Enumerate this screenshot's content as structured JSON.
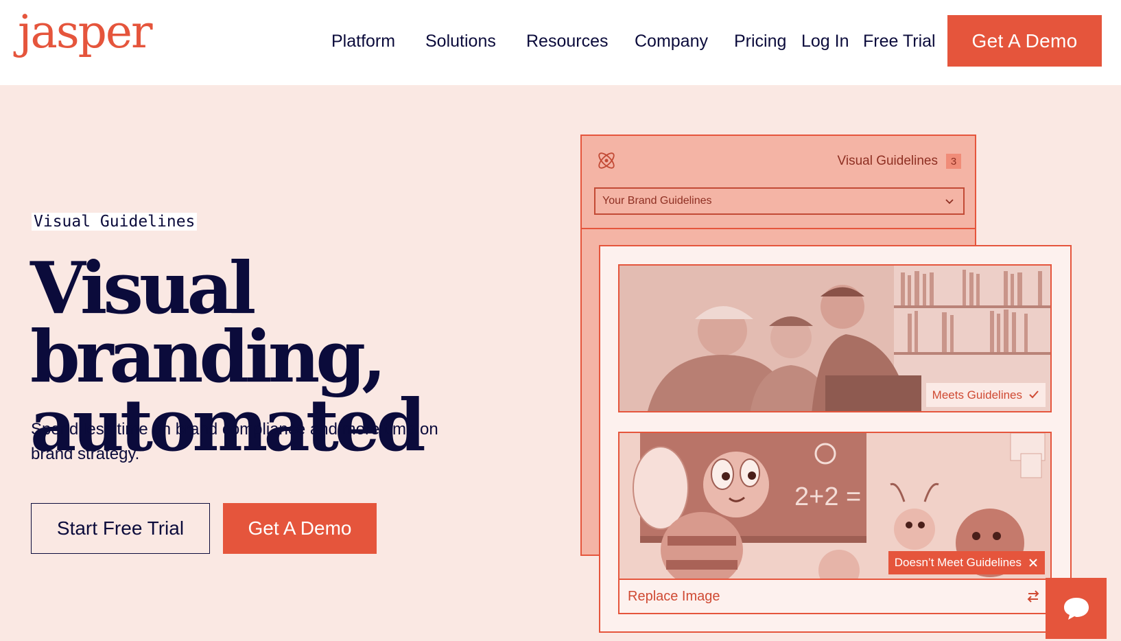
{
  "brand": {
    "logo_text": "jasper",
    "accent_color": "#e5553c",
    "navy": "#0b0b3b"
  },
  "nav": {
    "items": [
      "Platform",
      "Solutions",
      "Resources",
      "Company",
      "Pricing",
      "Log In",
      "Free Trial"
    ],
    "demo_label": "Get A Demo"
  },
  "hero": {
    "eyebrow": "Visual Guidelines",
    "headline_line1": "Visual branding,",
    "headline_line2": "automated",
    "subtext": "Spend less time on brand compliance and more time on brand strategy.",
    "trial_label": "Start Free Trial",
    "demo_label": "Get A Demo"
  },
  "app_mock": {
    "panel_title": "Visual Guidelines",
    "panel_count": "3",
    "select_value": "Your Brand Guidelines",
    "image1_status": "Meets Guidelines",
    "image1_status_icon": "check-icon",
    "image2_chalkboard_text": "2+2 =",
    "image2_status": "Doesn’t Meet Guidelines",
    "image2_status_icon": "close-icon",
    "replace_label": "Replace Image",
    "replace_icon": "swap-arrows-icon"
  },
  "chat": {
    "icon": "chat-bubble-icon"
  }
}
